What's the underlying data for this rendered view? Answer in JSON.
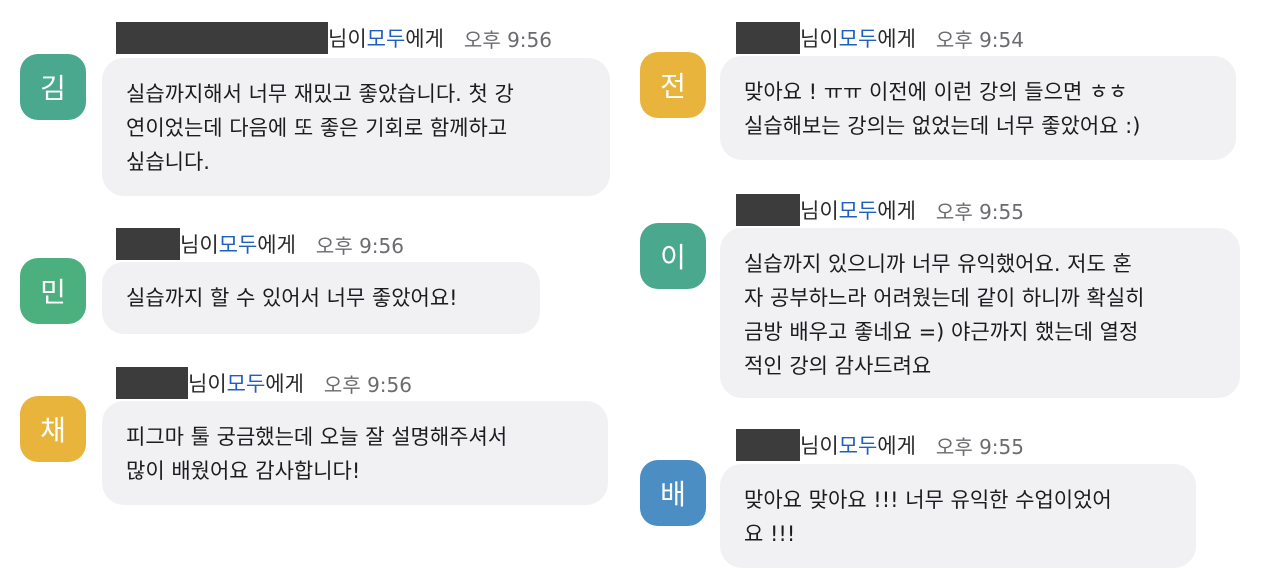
{
  "messages": [
    {
      "initial": "김",
      "avatar_color": "#4aa88e",
      "sender_suffix": "님이 ",
      "target": "모두",
      "target_suffix": "에게",
      "time": "오후 9:56",
      "text": "실습까지해서 너무 재밌고 좋았습니다. 첫 강\n연이었는데 다음에 또 좋은 기회로 함께하고\n싶습니다."
    },
    {
      "initial": "민",
      "avatar_color": "#4bb07e",
      "sender_suffix": "님이 ",
      "target": "모두",
      "target_suffix": "에게",
      "time": "오후 9:56",
      "text": "실습까지 할 수 있어서 너무 좋았어요!"
    },
    {
      "initial": "채",
      "avatar_color": "#e9b43c",
      "sender_suffix": "님이 ",
      "target": "모두",
      "target_suffix": "에게",
      "time": "오후 9:56",
      "text": "피그마 툴 궁금했는데 오늘 잘 설명해주셔서\n많이 배웠어요 감사합니다!"
    },
    {
      "initial": "전",
      "avatar_color": "#e9b43c",
      "sender_suffix": "님이 ",
      "target": "모두",
      "target_suffix": "에게",
      "time": "오후 9:54",
      "text": "맞아요 ! ㅠㅠ 이전에 이런 강의 들으면 ㅎㅎ\n실습해보는 강의는 없었는데 너무 좋았어요 :)"
    },
    {
      "initial": "이",
      "avatar_color": "#4aa88e",
      "sender_suffix": "님이 ",
      "target": "모두",
      "target_suffix": "에게",
      "time": "오후 9:55",
      "text": "실습까지 있으니까 너무 유익했어요. 저도 혼\n자 공부하느라 어려웠는데 같이 하니까 확실히\n금방 배우고 좋네요 =) 야근까지 했는데 열정\n적인 강의 감사드려요"
    },
    {
      "initial": "배",
      "avatar_color": "#4a8ec4",
      "sender_suffix": "님이 ",
      "target": "모두",
      "target_suffix": "에게",
      "time": "오후 9:55",
      "text": "맞아요 맞아요 !!! 너무 유익한 수업이었어\n요 !!!"
    }
  ]
}
